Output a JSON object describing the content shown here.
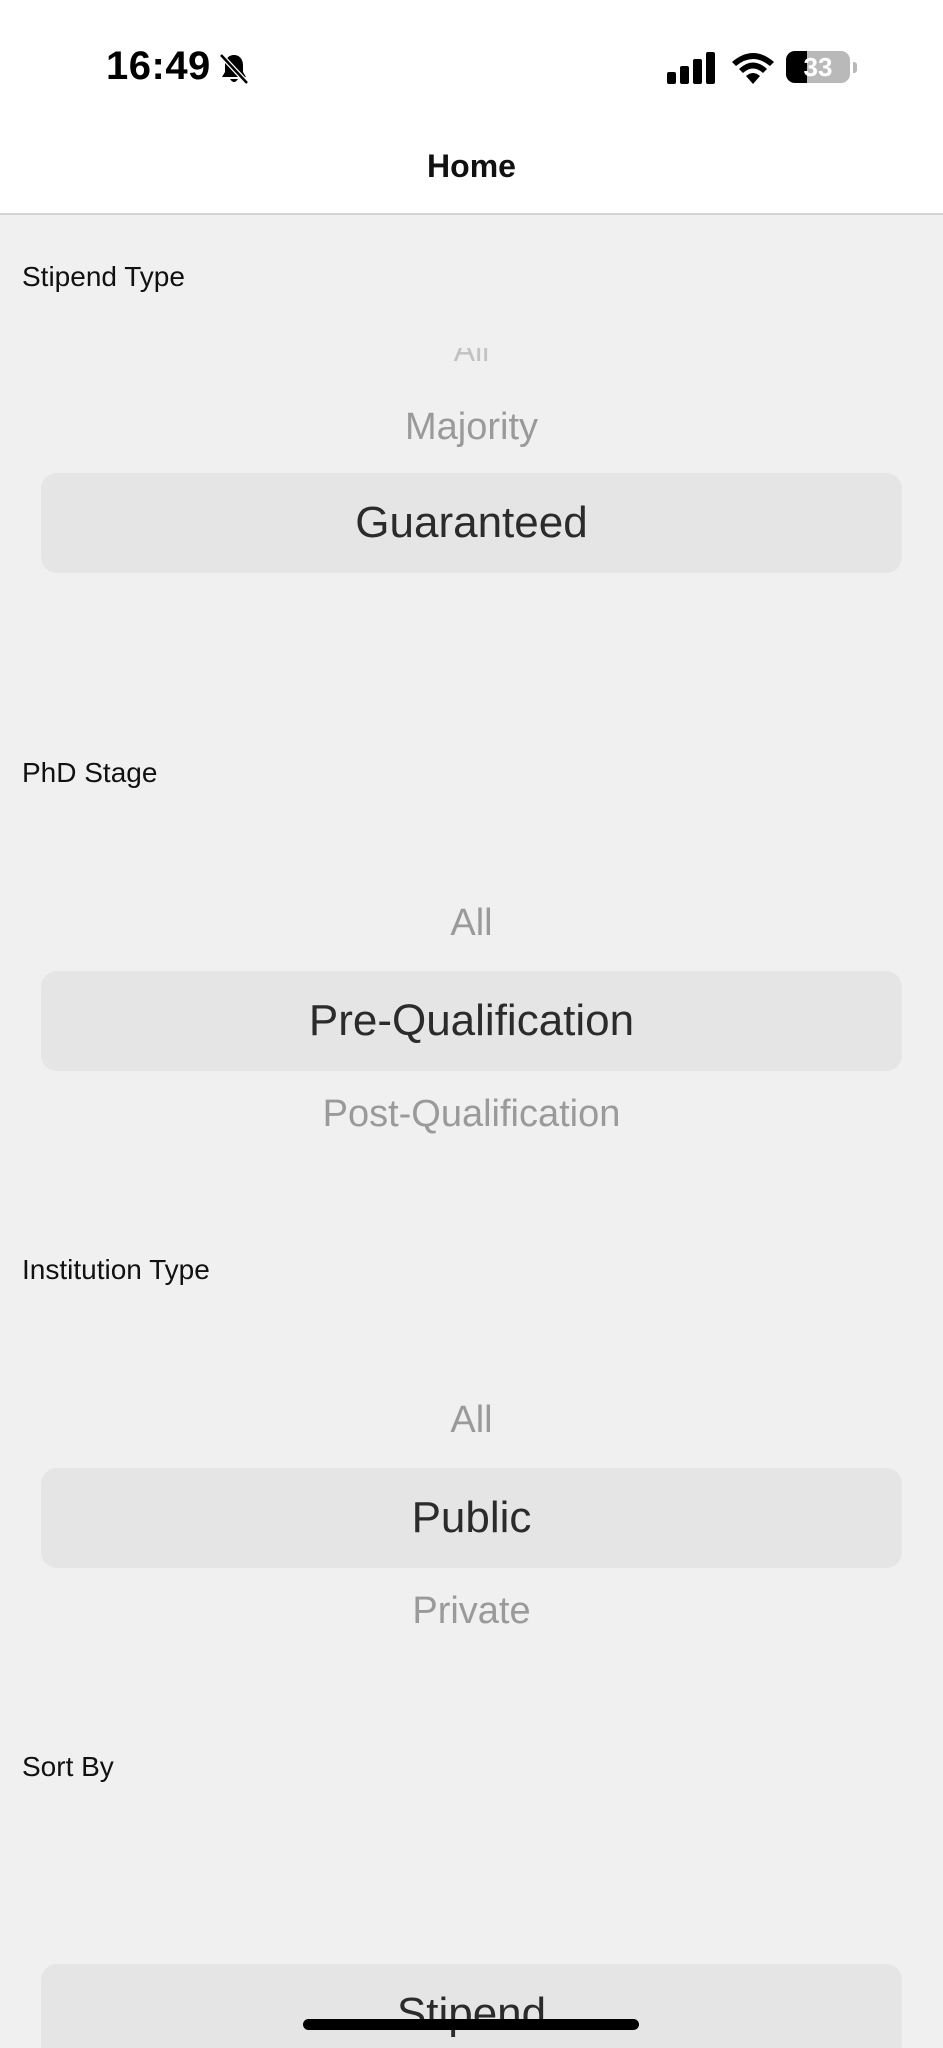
{
  "status_bar": {
    "time": "16:49",
    "battery_percent": "33",
    "battery_level": 0.33,
    "icons": [
      "bell-slash-icon",
      "signal-icon",
      "wifi-icon",
      "battery-icon"
    ]
  },
  "nav": {
    "title": "Home"
  },
  "filters": {
    "stipend_type": {
      "label": "Stipend Type",
      "options": [
        "All",
        "Majority",
        "Guaranteed"
      ],
      "selected": "Guaranteed"
    },
    "phd_stage": {
      "label": "PhD Stage",
      "options": [
        "All",
        "Pre-Qualification",
        "Post-Qualification"
      ],
      "selected": "Pre-Qualification"
    },
    "institution_type": {
      "label": "Institution Type",
      "options": [
        "All",
        "Public",
        "Private"
      ],
      "selected": "Public"
    },
    "sort_by": {
      "label": "Sort By",
      "options": [
        "Stipend"
      ],
      "selected": "Stipend"
    }
  },
  "colors": {
    "background": "#f0f0f0",
    "highlight": "#e5e5e5",
    "selected_text": "#2b2b2b",
    "unselected_text": "#9a9a9a"
  }
}
